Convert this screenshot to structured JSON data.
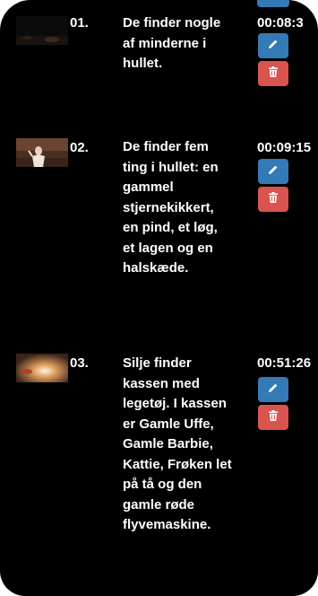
{
  "scenes": [
    {
      "number": "01.",
      "description": "De finder nogle af minderne i hullet.",
      "time": "00:08:3",
      "edit_icon": "pencil-icon",
      "delete_icon": "trash-icon"
    },
    {
      "number": "02.",
      "description": "De finder fem ting i hullet: en gammel stjernekikkert, en pind, et løg, et lagen og en halskæde.",
      "time": "00:09:15",
      "edit_icon": "pencil-icon",
      "delete_icon": "trash-icon"
    },
    {
      "number": "03.",
      "description": "Silje finder kassen med legetøj. I kassen er Gamle Uffe, Gamle Barbie, Kattie, Frøken let på tå og den gamle røde flyvemaskine.",
      "time": "00:51:26",
      "edit_icon": "pencil-icon",
      "delete_icon": "trash-icon"
    }
  ],
  "colors": {
    "background": "#000000",
    "edit_button": "#337ab7",
    "delete_button": "#d9534f",
    "text": "#ffffff"
  }
}
